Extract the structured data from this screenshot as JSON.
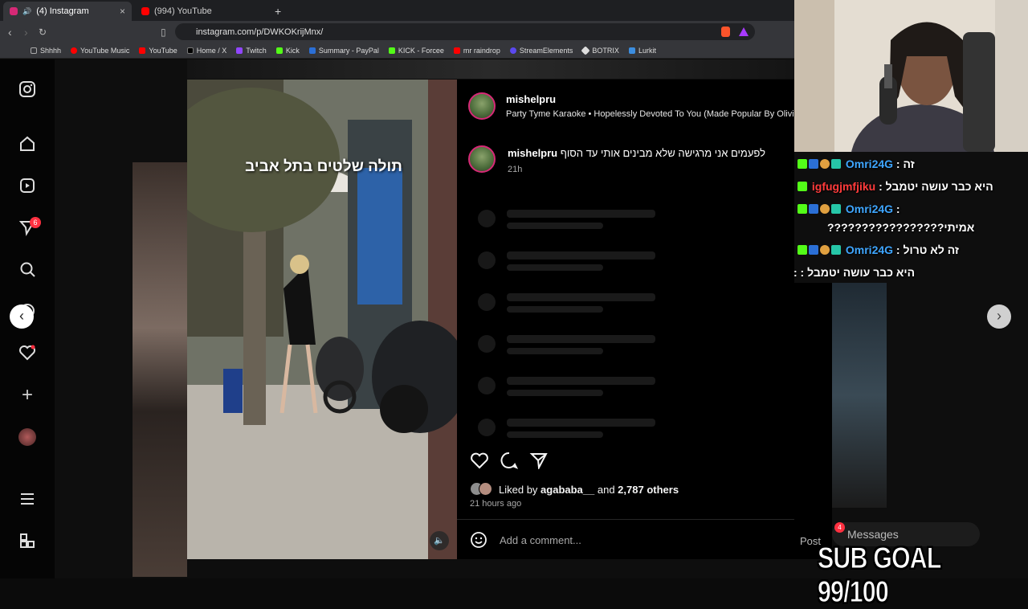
{
  "browser": {
    "tabs": [
      {
        "label": "(4) Instagram",
        "active": true
      },
      {
        "label": "(994) YouTube",
        "active": false
      }
    ],
    "url": "instagram.com/p/DWKOKrijMnx/",
    "bookmarks": [
      "Shhhh",
      "YouTube Music",
      "YouTube",
      "Home / X",
      "Twitch",
      "Kick",
      "Summary - PayPal",
      "KICK - Forcee",
      "mr raindrop",
      "StreamElements",
      "BOTRIX",
      "Lurkit"
    ]
  },
  "sidebar": {
    "notification_count": "6"
  },
  "post": {
    "username": "mishelpru",
    "audio": "Party Tyme Karaoke • Hopelessly Devoted To You (Made Popular By Olivi",
    "overlay_text": "תולה שלטים בתל אביב",
    "caption_user": "mishelpru",
    "caption_text": "לפעמים אני מרגישה שלא מבינים אותי עד הסוף",
    "caption_time": "21h",
    "liked_by_prefix": "Liked by ",
    "liked_by_user": "agababa__",
    "liked_by_and": " and ",
    "liked_by_others": "2,787 others",
    "time_ago": "21 hours ago",
    "comment_placeholder": "Add a comment...",
    "post_button": "Post"
  },
  "messages": {
    "label": "Messages",
    "badge": "4"
  },
  "stream": {
    "chat": [
      {
        "user": "Omri24G",
        "msg": "זה :",
        "user_color": "#3ea6ff"
      },
      {
        "user": "igfugjmfjiku",
        "msg": "היא כבר עושה יטמבל :",
        "user_color": "#ff3b3b"
      },
      {
        "user": "Omri24G",
        "msg": ":",
        "user_color": "#3ea6ff"
      },
      {
        "user": "",
        "msg": "אמיתי?????????????????",
        "user_color": "#ffffff"
      },
      {
        "user": "Omri24G",
        "msg": "זה לא טרול :",
        "user_color": "#3ea6ff"
      },
      {
        "user": "",
        "msg": "היא כבר עושה יטמבל : :",
        "user_color": "#ffffff"
      }
    ],
    "sub_goal": "SUB GOAL 99/100"
  },
  "colors": {
    "like_badge": "#ff3040",
    "link_blue": "#3ea6ff",
    "kick_green": "#53fc18"
  }
}
